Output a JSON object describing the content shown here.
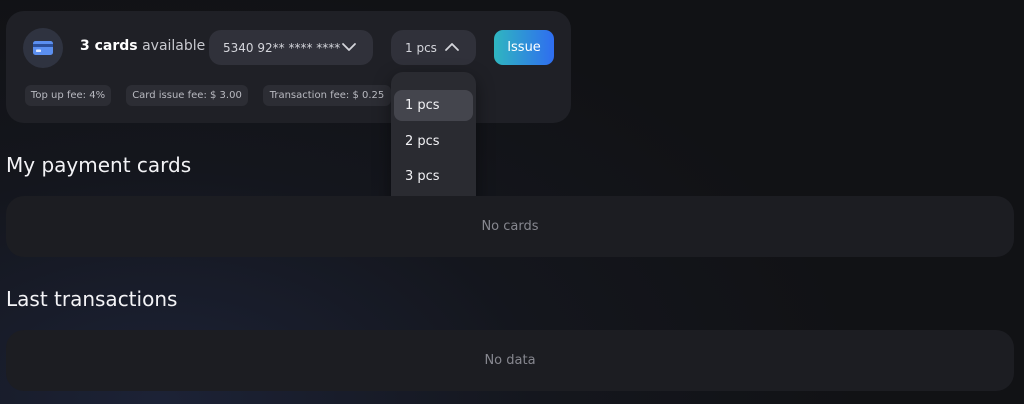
{
  "issue_panel": {
    "cards_count": "3 cards",
    "cards_suffix": "available",
    "card_select_value": "5340 92** **** ****",
    "quantity_value": "1 pcs",
    "issue_label": "Issue",
    "fees": {
      "top_up": "Top up fee: 4%",
      "card_issue": "Card issue fee: $ 3.00",
      "transaction": "Transaction fee: $ 0.25"
    }
  },
  "quantity_dropdown": {
    "options": [
      "1 pcs",
      "2 pcs",
      "3 pcs"
    ],
    "selected": "1 pcs"
  },
  "payment_cards": {
    "title": "My payment cards",
    "empty_text": "No cards"
  },
  "transactions": {
    "title": "Last transactions",
    "empty_text": "No data"
  },
  "colors": {
    "issue_gradient_start": "#2fb6c0",
    "issue_gradient_end": "#2f6df0",
    "card_icon": "#5b8ff0"
  }
}
